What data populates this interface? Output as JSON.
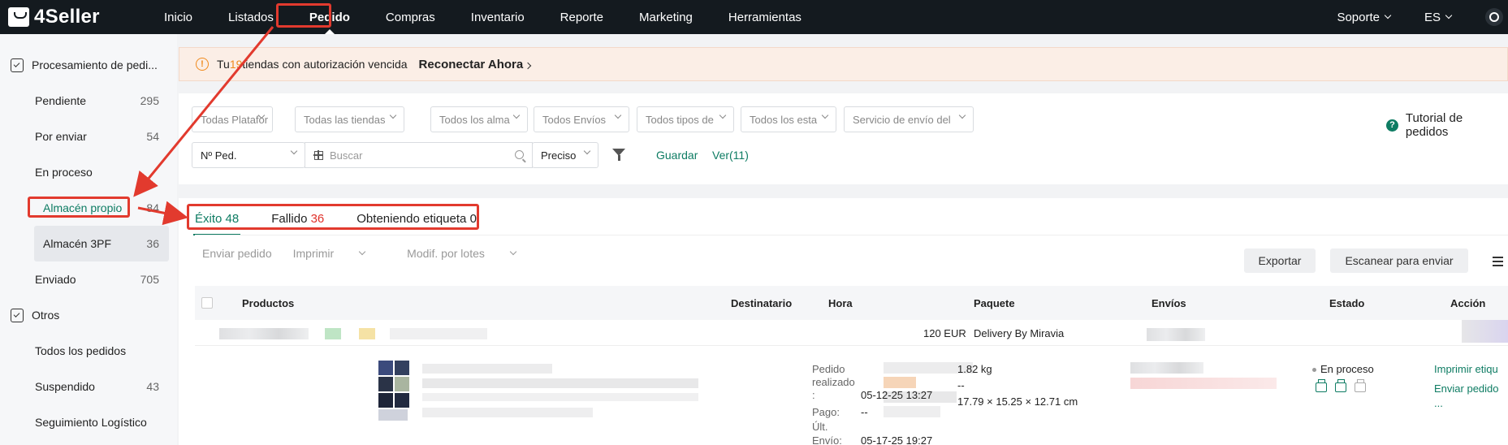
{
  "app": {
    "logo_text": "4Seller"
  },
  "nav": {
    "items": [
      "Inicio",
      "Listados",
      "Pedido",
      "Compras",
      "Inventario",
      "Reporte",
      "Marketing",
      "Herramientas"
    ],
    "support": "Soporte",
    "language": "ES"
  },
  "sidebar": {
    "group1": "Procesamiento de pedi...",
    "items": [
      {
        "label": "Pendiente",
        "count": "295"
      },
      {
        "label": "Por enviar",
        "count": "54"
      },
      {
        "label": "En proceso",
        "count": ""
      },
      {
        "label": "Almacén propio",
        "count": "84"
      },
      {
        "label": "Almacén 3PF",
        "count": "36"
      },
      {
        "label": "Enviado",
        "count": "705"
      }
    ],
    "group2": "Otros",
    "items2": [
      {
        "label": "Todos los pedidos",
        "count": ""
      },
      {
        "label": "Suspendido",
        "count": "43"
      },
      {
        "label": "Seguimiento Logístico",
        "count": ""
      }
    ]
  },
  "banner": {
    "pre": "Tu ",
    "count": "19",
    "post": " tiendas con autorización vencida",
    "action": "Reconectar Ahora"
  },
  "filters": {
    "selects": [
      "Todas Platafor",
      "Todas las tiendas",
      "Todos los alma",
      "Todos Envíos",
      "Todos tipos de",
      "Todos los esta",
      "Servicio de envío del"
    ],
    "order_field": "Nº Ped.",
    "search_placeholder": "Buscar",
    "match": "Preciso",
    "save": "Guardar",
    "view": "Ver(11)",
    "tutorial": "Tutorial de pedidos"
  },
  "tabs": [
    {
      "label": "Éxito",
      "count": "48"
    },
    {
      "label": "Fallido",
      "count": "36"
    },
    {
      "label": "Obteniendo etiqueta",
      "count": "0"
    }
  ],
  "toolbar": {
    "send": "Enviar pedido",
    "print": "Imprimir",
    "bulk": "Modif. por lotes",
    "export": "Exportar",
    "scan": "Escanear para enviar"
  },
  "table": {
    "headers": [
      "Productos",
      "Destinatario",
      "Hora",
      "Paquete",
      "Envíos",
      "Estado",
      "Acción"
    ],
    "group": {
      "amount": "120 EUR",
      "carrier": "Delivery By Miravia"
    },
    "row": {
      "placed_label_1": "Pedido",
      "placed_label_2": "realizado",
      "placed_label_3": ":",
      "placed_value": "05-12-25 13:27",
      "paid_label": "Pago:",
      "paid_value": "--",
      "last_label": "Últ.",
      "ship_label": "Envío:",
      "ship_value": "05-17-25 19:27",
      "weight": "1.82 kg",
      "dash": "--",
      "dims": "17.79 × 15.25 × 12.71 cm",
      "status": "En proceso",
      "action_print": "Imprimir etiqu",
      "action_send": "Enviar pedido",
      "action_more": "..."
    }
  },
  "colors": {
    "accent": "#0e7c63",
    "warn": "#f08a1c",
    "error": "#e0312a",
    "annotation": "#e23a2e"
  }
}
